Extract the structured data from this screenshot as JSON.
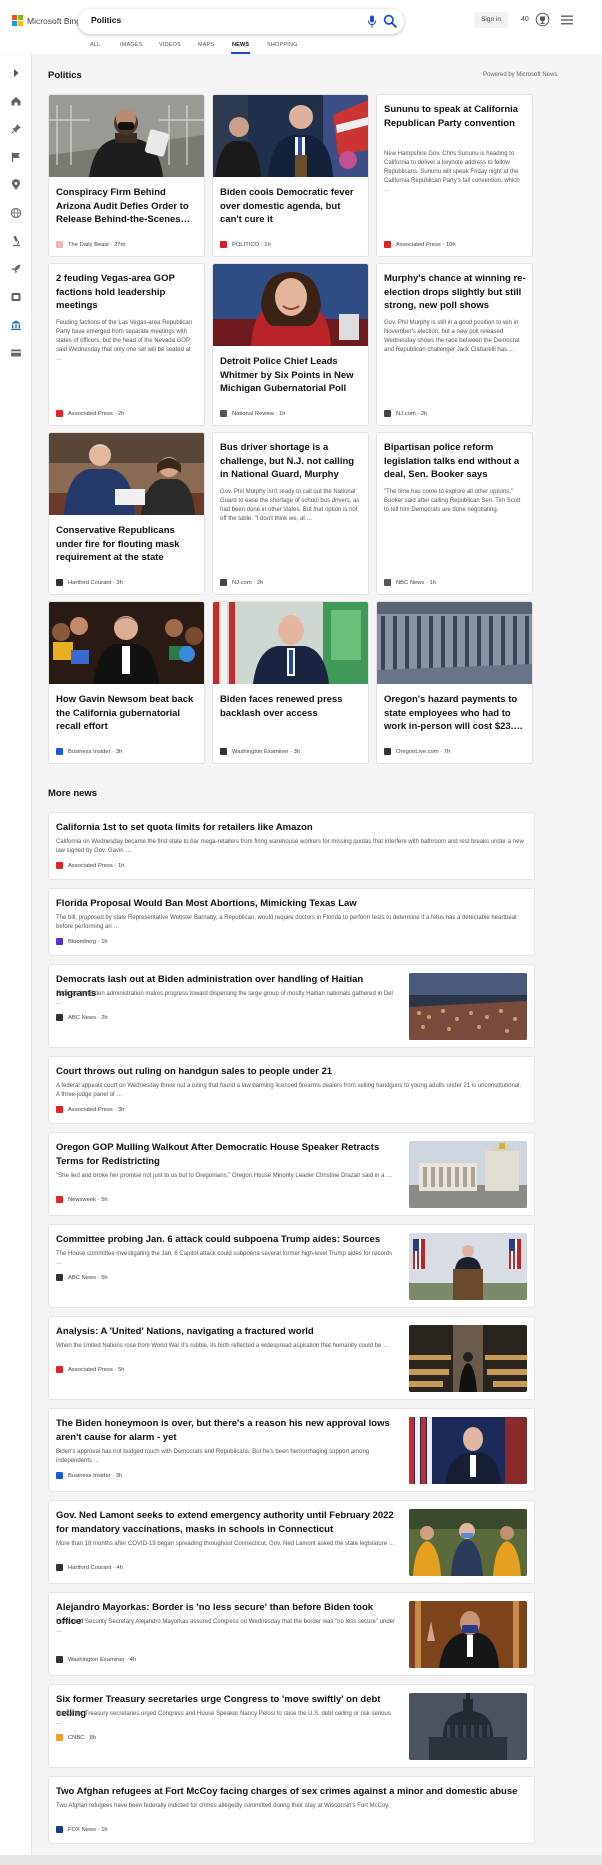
{
  "header": {
    "logo_text": "Microsoft Bing",
    "search_value": "Politics",
    "signin_label": "Sign in",
    "rewards_count": "40",
    "scopes": [
      "ALL",
      "IMAGES",
      "VIDEOS",
      "MAPS",
      "NEWS",
      "SHOPPING"
    ],
    "active_scope": "NEWS"
  },
  "rail": {
    "icons": [
      "expand-arrow-icon",
      "home-icon",
      "pin-icon",
      "flag-icon",
      "location-icon",
      "globe-icon",
      "microscope-icon",
      "rocket-icon",
      "film-icon",
      "bank-icon",
      "card-icon"
    ]
  },
  "main": {
    "title": "Politics",
    "powered_by": "Powered by Microsoft News",
    "more_title": "More news"
  },
  "cards": [
    {
      "title": "Conspiracy Firm Behind Arizona Audit Defies Order to Release Behind-the-Scenes…",
      "snippet": "",
      "provider": "The Daily Beast",
      "time": "27m",
      "provider_color": "#f2b3b9",
      "has_image": true
    },
    {
      "title": "Biden cools Democratic fever over domestic agenda, but can't cure it",
      "snippet": "",
      "provider": "POLITICO",
      "time": "1h",
      "provider_color": "#d81f26",
      "has_image": true
    },
    {
      "title": "Sununu to speak at California Republican Party convention",
      "snippet": "New Hampshire Gov. Chris Sununu is heading to California to deliver a keynote address to fellow Republicans. Sununu will speak Friday night at the California Republican Party's fall convention, which …",
      "provider": "Associated Press",
      "time": "10h",
      "provider_color": "#e32526",
      "has_image": false
    },
    {
      "title": "2 feuding Vegas-area GOP factions hold leadership meetings",
      "snippet": "Feuding factions of the Las Vegas-area Republican Party have emerged from separate meetings with slates of officers, but the head of the Nevada GOP said Wednesday that only one set will be seated at …",
      "provider": "Associated Press",
      "time": "2h",
      "provider_color": "#e32526",
      "has_image": false
    },
    {
      "title": "Detroit Police Chief Leads Whitmer by Six Points in New Michigan Gubernatorial Poll",
      "snippet": "",
      "provider": "National Review",
      "time": "1h",
      "provider_color": "#555555",
      "has_image": true
    },
    {
      "title": "Murphy's chance at winning re-election drops slightly but still strong, new poll shows",
      "snippet": "Gov. Phil Murphy is still in a good position to win in November's election, but a new poll released Wednesday shows the race between the Democrat and Republican challenger Jack Ciattarelli has …",
      "provider": "NJ.com",
      "time": "2h",
      "provider_color": "#444444",
      "has_image": false
    },
    {
      "title": "Conservative Republicans under fire for flouting mask requirement at the state Capit…",
      "snippet": "",
      "provider": "Hartford Courant",
      "time": "3h",
      "provider_color": "#333333",
      "has_image": true
    },
    {
      "title": "Bus driver shortage is a challenge, but N.J. not calling in National Guard, Murphy says",
      "snippet": "Gov. Phil Murphy isn't ready to call out the National Guard to ease the shortage of school bus drivers, as had been done in other states. But that option is not off the table. \"I don't think we, at …",
      "provider": "NJ.com",
      "time": "2h",
      "provider_color": "#444444",
      "has_image": false
    },
    {
      "title": "Bipartisan police reform legislation talks end without a deal, Sen. Booker says",
      "snippet": "\"The time has come to explore all other options,\" Booker said after calling Republican Sen. Tim Scott to tell him Democrats are done negotiating.",
      "provider": "NBC News",
      "time": "1h",
      "provider_color": "#555555",
      "has_image": false
    },
    {
      "title": "How Gavin Newsom beat back the California gubernatorial recall effort",
      "snippet": "",
      "provider": "Business Insider",
      "time": "3h",
      "provider_color": "#1a5be0",
      "has_image": true
    },
    {
      "title": "Biden faces renewed press backlash over access",
      "snippet": "",
      "provider": "Washington Examiner",
      "time": "3h",
      "provider_color": "#333333",
      "has_image": true
    },
    {
      "title": "Oregon's hazard payments to state employees who had to work in-person will cost $23.…",
      "snippet": "",
      "provider": "OregonLive.com",
      "time": "7h",
      "provider_color": "#333333",
      "has_image": true
    }
  ],
  "more_news": [
    {
      "title": "California 1st to set quota limits for retailers like Amazon",
      "snippet": "California on Wednesday became the first state to bar mega-retailers from firing warehouse workers for missing quotas that interfere with bathroom and rest breaks under a new law signed by Gov. Gavin …",
      "provider": "Associated Press",
      "time": "1h",
      "provider_color": "#e32526",
      "has_thumb": false
    },
    {
      "title": "Florida Proposal Would Ban Most Abortions, Mimicking Texas Law",
      "snippet": "The bill, proposed by state Representative Webster Barnaby, a Republican, would require doctors in Florida to perform tests to determine if a fetus has a detectable heartbeat before performing an …",
      "provider": "Bloomberg",
      "time": "1h",
      "provider_color": "#5b2be0",
      "has_thumb": false
    },
    {
      "title": "Democrats lash out at Biden administration over handling of Haitian migrants",
      "snippet": "Even as the Biden administration makes progress toward dispersing the large group of mostly Haitian nationals gathered in Del …",
      "provider": "ABC News",
      "time": "2h",
      "provider_color": "#333333",
      "has_thumb": true
    },
    {
      "title": "Court throws out ruling on handgun sales to people under 21",
      "snippet": "A federal appeals court on Wednesday threw out a ruling that found a law banning licensed firearms dealers from selling handguns to young adults under 21 is unconstitutional. A three-judge panel of …",
      "provider": "Associated Press",
      "time": "3h",
      "provider_color": "#e32526",
      "has_thumb": false
    },
    {
      "title": "Oregon GOP Mulling Walkout After Democratic House Speaker Retracts Terms for Redistricting",
      "snippet": "\"She lied and broke her promise not just to us but to Oregonians,\" Oregon House Minority Leader Christine Drazan said in a …",
      "provider": "Newsweek",
      "time": "5h",
      "provider_color": "#e32526",
      "has_thumb": true
    },
    {
      "title": "Committee probing Jan. 6 attack could subpoena Trump aides: Sources",
      "snippet": "The House committee investigating the Jan. 6 Capitol attack could subpoena several former high-level Trump aides for records …",
      "provider": "ABC News",
      "time": "5h",
      "provider_color": "#333333",
      "has_thumb": true
    },
    {
      "title": "Analysis: A 'United' Nations, navigating a fractured world",
      "snippet": "When the United Nations rose from World War II's rubble, its birth reflected a widespread aspiration that humanity could be …",
      "provider": "Associated Press",
      "time": "5h",
      "provider_color": "#e32526",
      "has_thumb": true
    },
    {
      "title": "The Biden honeymoon is over, but there's a reason his new approval lows aren't cause for alarm - yet",
      "snippet": "Biden's approval has not budged much with Democrats and Republicans. But he's been hemorrhaging support among independents …",
      "provider": "Business Insider",
      "time": "3h",
      "provider_color": "#1a5be0",
      "has_thumb": true
    },
    {
      "title": "Gov. Ned Lamont seeks to extend emergency authority until February 2022 for mandatory vaccinations, masks in schools in Connecticut",
      "snippet": "More than 18 months after COVID-19 began spreading throughout Connecticut, Gov. Ned Lamont asked the state legislature …",
      "provider": "Hartford Courant",
      "time": "4h",
      "provider_color": "#333333",
      "has_thumb": true
    },
    {
      "title": "Alejandro Mayorkas: Border is 'no less secure' than before Biden took office",
      "snippet": "Homeland Security Secretary Alejandro Mayorkas assured Congress on Wednesday that the border was \"no less secure\" under …",
      "provider": "Washington Examiner",
      "time": "4h",
      "provider_color": "#333333",
      "has_thumb": true
    },
    {
      "title": "Six former Treasury secretaries urge Congress to 'move swiftly' on debt ceiling",
      "snippet": "Six former Treasury secretaries urged Congress and House Speaker Nancy Pelosi to raise the U.S. debt ceiling or risk serious …",
      "provider": "CNBC",
      "time": "8h",
      "provider_color": "#f0a020",
      "has_thumb": true
    },
    {
      "title": "Two Afghan refugees at Fort McCoy facing charges of sex crimes against a minor and domestic abuse",
      "snippet": "Two Afghan refugees have been federally indicted for crimes allegedly committed during their stay at Wisconsin's Fort McCoy.",
      "provider": "FOX News",
      "time": "1h",
      "provider_color": "#1a3a8a",
      "has_thumb": false
    }
  ],
  "colors": {
    "accent": "#174ae4",
    "background": "#f5f5f5"
  }
}
